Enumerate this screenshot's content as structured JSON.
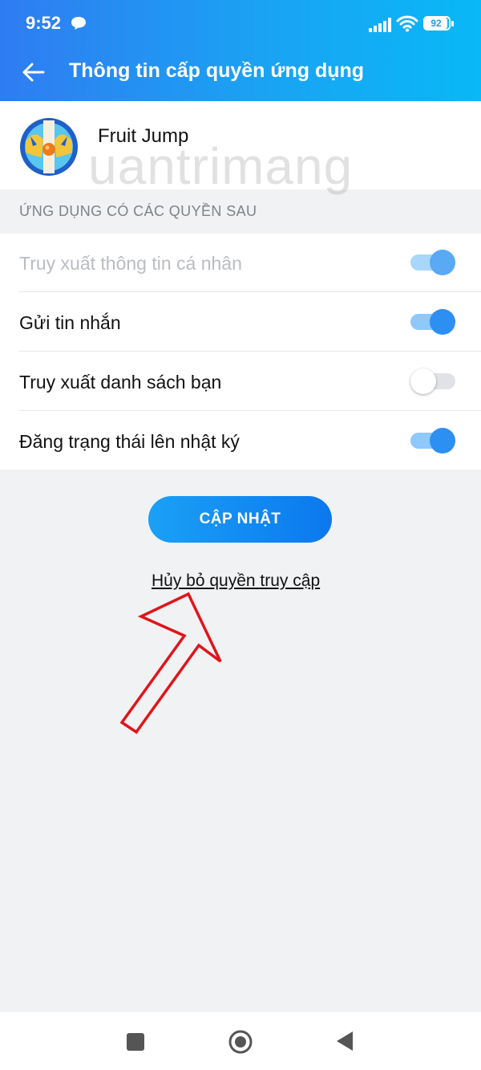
{
  "status_bar": {
    "time": "9:52",
    "battery": "92"
  },
  "header": {
    "title": "Thông tin cấp quyền ứng dụng"
  },
  "app": {
    "name": "Fruit Jump",
    "watermark": "uantrimang"
  },
  "permissions": {
    "section_label": "ỨNG DỤNG CÓ CÁC QUYỀN SAU",
    "items": [
      {
        "label": "Truy xuất thông tin cá nhân",
        "enabled": true,
        "disabled": true
      },
      {
        "label": "Gửi tin nhắn",
        "enabled": true,
        "disabled": false
      },
      {
        "label": "Truy xuất danh sách bạn",
        "enabled": false,
        "disabled": false
      },
      {
        "label": "Đăng trạng thái lên nhật ký",
        "enabled": true,
        "disabled": false
      }
    ]
  },
  "actions": {
    "update_label": "CẬP NHẬT",
    "revoke_label": "Hủy bỏ quyền truy cập"
  },
  "colors": {
    "accent": "#2e8ff2",
    "header_start": "#2f7cf2",
    "header_end": "#08b8f7",
    "annotation": "#e0151b"
  },
  "icons": {
    "back": "arrow-left-icon",
    "recent": "square-icon",
    "home": "circle-icon",
    "nav_back": "triangle-left-icon"
  }
}
